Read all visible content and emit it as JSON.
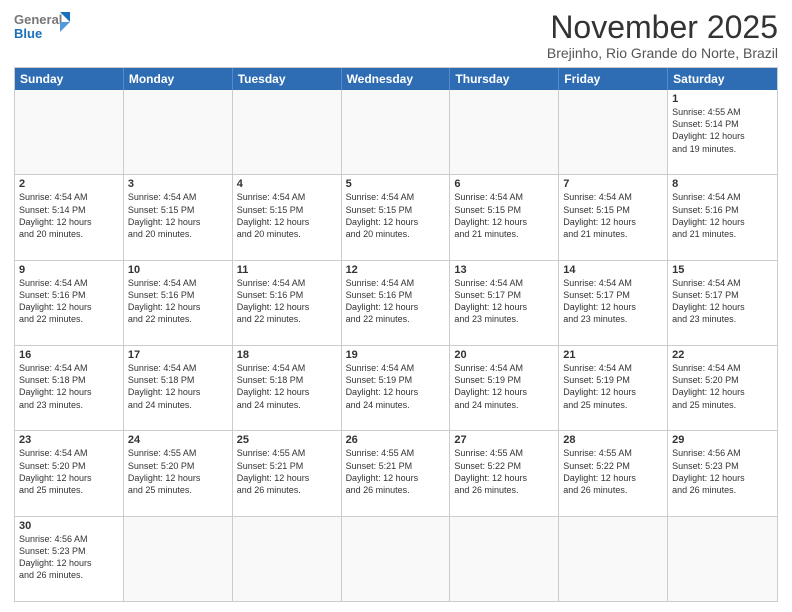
{
  "header": {
    "logo_general": "General",
    "logo_blue": "Blue",
    "month_title": "November 2025",
    "subtitle": "Brejinho, Rio Grande do Norte, Brazil"
  },
  "day_headers": [
    "Sunday",
    "Monday",
    "Tuesday",
    "Wednesday",
    "Thursday",
    "Friday",
    "Saturday"
  ],
  "weeks": [
    [
      {
        "day": "",
        "empty": true,
        "info": ""
      },
      {
        "day": "",
        "empty": true,
        "info": ""
      },
      {
        "day": "",
        "empty": true,
        "info": ""
      },
      {
        "day": "",
        "empty": true,
        "info": ""
      },
      {
        "day": "",
        "empty": true,
        "info": ""
      },
      {
        "day": "",
        "empty": true,
        "info": ""
      },
      {
        "day": "1",
        "empty": false,
        "info": "Sunrise: 4:55 AM\nSunset: 5:14 PM\nDaylight: 12 hours\nand 19 minutes."
      }
    ],
    [
      {
        "day": "2",
        "empty": false,
        "info": "Sunrise: 4:54 AM\nSunset: 5:14 PM\nDaylight: 12 hours\nand 20 minutes."
      },
      {
        "day": "3",
        "empty": false,
        "info": "Sunrise: 4:54 AM\nSunset: 5:15 PM\nDaylight: 12 hours\nand 20 minutes."
      },
      {
        "day": "4",
        "empty": false,
        "info": "Sunrise: 4:54 AM\nSunset: 5:15 PM\nDaylight: 12 hours\nand 20 minutes."
      },
      {
        "day": "5",
        "empty": false,
        "info": "Sunrise: 4:54 AM\nSunset: 5:15 PM\nDaylight: 12 hours\nand 20 minutes."
      },
      {
        "day": "6",
        "empty": false,
        "info": "Sunrise: 4:54 AM\nSunset: 5:15 PM\nDaylight: 12 hours\nand 21 minutes."
      },
      {
        "day": "7",
        "empty": false,
        "info": "Sunrise: 4:54 AM\nSunset: 5:15 PM\nDaylight: 12 hours\nand 21 minutes."
      },
      {
        "day": "8",
        "empty": false,
        "info": "Sunrise: 4:54 AM\nSunset: 5:16 PM\nDaylight: 12 hours\nand 21 minutes."
      }
    ],
    [
      {
        "day": "9",
        "empty": false,
        "info": "Sunrise: 4:54 AM\nSunset: 5:16 PM\nDaylight: 12 hours\nand 22 minutes."
      },
      {
        "day": "10",
        "empty": false,
        "info": "Sunrise: 4:54 AM\nSunset: 5:16 PM\nDaylight: 12 hours\nand 22 minutes."
      },
      {
        "day": "11",
        "empty": false,
        "info": "Sunrise: 4:54 AM\nSunset: 5:16 PM\nDaylight: 12 hours\nand 22 minutes."
      },
      {
        "day": "12",
        "empty": false,
        "info": "Sunrise: 4:54 AM\nSunset: 5:16 PM\nDaylight: 12 hours\nand 22 minutes."
      },
      {
        "day": "13",
        "empty": false,
        "info": "Sunrise: 4:54 AM\nSunset: 5:17 PM\nDaylight: 12 hours\nand 23 minutes."
      },
      {
        "day": "14",
        "empty": false,
        "info": "Sunrise: 4:54 AM\nSunset: 5:17 PM\nDaylight: 12 hours\nand 23 minutes."
      },
      {
        "day": "15",
        "empty": false,
        "info": "Sunrise: 4:54 AM\nSunset: 5:17 PM\nDaylight: 12 hours\nand 23 minutes."
      }
    ],
    [
      {
        "day": "16",
        "empty": false,
        "info": "Sunrise: 4:54 AM\nSunset: 5:18 PM\nDaylight: 12 hours\nand 23 minutes."
      },
      {
        "day": "17",
        "empty": false,
        "info": "Sunrise: 4:54 AM\nSunset: 5:18 PM\nDaylight: 12 hours\nand 24 minutes."
      },
      {
        "day": "18",
        "empty": false,
        "info": "Sunrise: 4:54 AM\nSunset: 5:18 PM\nDaylight: 12 hours\nand 24 minutes."
      },
      {
        "day": "19",
        "empty": false,
        "info": "Sunrise: 4:54 AM\nSunset: 5:19 PM\nDaylight: 12 hours\nand 24 minutes."
      },
      {
        "day": "20",
        "empty": false,
        "info": "Sunrise: 4:54 AM\nSunset: 5:19 PM\nDaylight: 12 hours\nand 24 minutes."
      },
      {
        "day": "21",
        "empty": false,
        "info": "Sunrise: 4:54 AM\nSunset: 5:19 PM\nDaylight: 12 hours\nand 25 minutes."
      },
      {
        "day": "22",
        "empty": false,
        "info": "Sunrise: 4:54 AM\nSunset: 5:20 PM\nDaylight: 12 hours\nand 25 minutes."
      }
    ],
    [
      {
        "day": "23",
        "empty": false,
        "info": "Sunrise: 4:54 AM\nSunset: 5:20 PM\nDaylight: 12 hours\nand 25 minutes."
      },
      {
        "day": "24",
        "empty": false,
        "info": "Sunrise: 4:55 AM\nSunset: 5:20 PM\nDaylight: 12 hours\nand 25 minutes."
      },
      {
        "day": "25",
        "empty": false,
        "info": "Sunrise: 4:55 AM\nSunset: 5:21 PM\nDaylight: 12 hours\nand 26 minutes."
      },
      {
        "day": "26",
        "empty": false,
        "info": "Sunrise: 4:55 AM\nSunset: 5:21 PM\nDaylight: 12 hours\nand 26 minutes."
      },
      {
        "day": "27",
        "empty": false,
        "info": "Sunrise: 4:55 AM\nSunset: 5:22 PM\nDaylight: 12 hours\nand 26 minutes."
      },
      {
        "day": "28",
        "empty": false,
        "info": "Sunrise: 4:55 AM\nSunset: 5:22 PM\nDaylight: 12 hours\nand 26 minutes."
      },
      {
        "day": "29",
        "empty": false,
        "info": "Sunrise: 4:56 AM\nSunset: 5:23 PM\nDaylight: 12 hours\nand 26 minutes."
      }
    ],
    [
      {
        "day": "30",
        "empty": false,
        "info": "Sunrise: 4:56 AM\nSunset: 5:23 PM\nDaylight: 12 hours\nand 26 minutes."
      },
      {
        "day": "",
        "empty": true,
        "info": ""
      },
      {
        "day": "",
        "empty": true,
        "info": ""
      },
      {
        "day": "",
        "empty": true,
        "info": ""
      },
      {
        "day": "",
        "empty": true,
        "info": ""
      },
      {
        "day": "",
        "empty": true,
        "info": ""
      },
      {
        "day": "",
        "empty": true,
        "info": ""
      }
    ]
  ]
}
